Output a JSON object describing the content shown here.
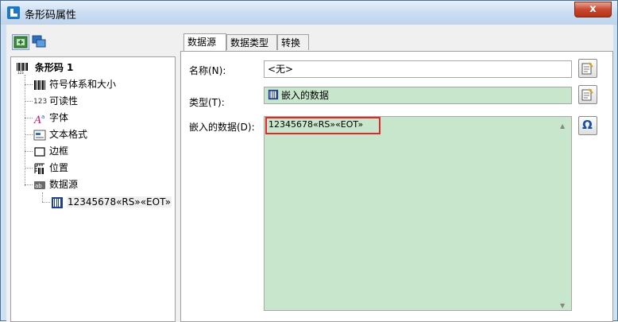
{
  "window": {
    "title": "条形码属性",
    "close_label": "x"
  },
  "tree": {
    "root": "条形码 1",
    "items": [
      {
        "label": "符号体系和大小",
        "icon": "barcode-icon"
      },
      {
        "label": "可读性",
        "icon": "readability-icon",
        "prefix": "123"
      },
      {
        "label": "字体",
        "icon": "font-icon"
      },
      {
        "label": "文本格式",
        "icon": "text-format-icon"
      },
      {
        "label": "边框",
        "icon": "border-icon"
      },
      {
        "label": "位置",
        "icon": "position-icon"
      },
      {
        "label": "数据源",
        "icon": "data-source-icon"
      }
    ],
    "child": "12345678«RS»«EOT»"
  },
  "tabs": [
    "数据源",
    "数据类型",
    "转换"
  ],
  "form": {
    "name_label": "名称(N):",
    "name_value": "<无>",
    "type_label": "类型(T):",
    "type_value": "嵌入的数据",
    "data_label": "嵌入的数据(D):",
    "data_value": "12345678«RS»«EOT»"
  },
  "colors": {
    "field_green": "#c8e6cc",
    "highlight": "#e02a2a",
    "title_bg": "#c9dcf1"
  }
}
